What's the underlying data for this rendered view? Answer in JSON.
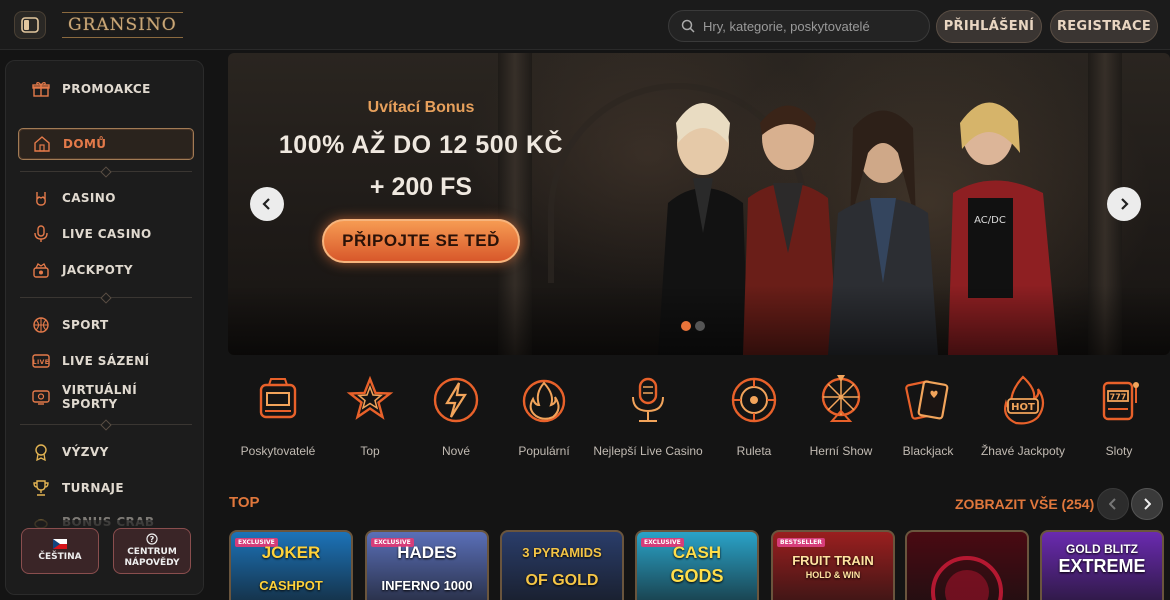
{
  "header": {
    "logo_text": "GRANSINO",
    "search_placeholder": "Hry, kategorie, poskytovatelé",
    "login_label": "PŘIHLÁŠENÍ",
    "register_label": "REGISTRACE"
  },
  "sidebar": {
    "items": [
      {
        "label": "PROMOAKCE",
        "icon": "gift-icon"
      },
      {
        "label": "DOMŮ",
        "icon": "home-icon",
        "active": true
      },
      {
        "label": "CASINO",
        "icon": "rock-hand-icon"
      },
      {
        "label": "LIVE CASINO",
        "icon": "microphone-icon"
      },
      {
        "label": "JACKPOTY",
        "icon": "jackpot-icon"
      },
      {
        "label": "SPORT",
        "icon": "basketball-icon"
      },
      {
        "label": "LIVE SÁZENÍ",
        "icon": "live-icon"
      },
      {
        "label": "VIRTUÁLNÍ SPORTY",
        "icon": "virtual-sports-icon"
      },
      {
        "label": "VÝZVY",
        "icon": "medal-icon"
      },
      {
        "label": "TURNAJE",
        "icon": "trophy-icon"
      },
      {
        "label": "BONUS CRAB",
        "icon": "crab-icon"
      }
    ],
    "language_label": "ČEŠTINA",
    "help_label_line1": "CENTRUM",
    "help_label_line2": "NÁPOVĚDY"
  },
  "hero": {
    "subtitle": "Uvítací Bonus",
    "title": "100% AŽ DO 12 500 KČ",
    "title_line2": "+ 200 FS",
    "cta_label": "PŘIPOJTE SE TEĎ",
    "slide_count": 2,
    "active_slide": 1
  },
  "categories": [
    {
      "label": "Poskytovatelé",
      "icon": "slot-machine-icon"
    },
    {
      "label": "Top",
      "icon": "star-icon"
    },
    {
      "label": "Nové",
      "icon": "lightning-icon"
    },
    {
      "label": "Populární",
      "icon": "flame-icon"
    },
    {
      "label": "Nejlepší Live Casino",
      "icon": "microphone-icon"
    },
    {
      "label": "Ruleta",
      "icon": "roulette-icon"
    },
    {
      "label": "Herní Show",
      "icon": "wheel-icon"
    },
    {
      "label": "Blackjack",
      "icon": "cards-icon"
    },
    {
      "label": "Žhavé Jackpoty",
      "icon": "hot-icon"
    },
    {
      "label": "Sloty",
      "icon": "slots-icon"
    }
  ],
  "top_section": {
    "title": "TOP",
    "show_all_label": "ZOBRAZIT VŠE (254)"
  },
  "games": [
    {
      "title": "JOKER",
      "subtitle": "CASHPOT",
      "badge": "EXCLUSIVE",
      "bg": "#1c73b8",
      "color": "#ffd23a"
    },
    {
      "title": "HADES",
      "subtitle": "INFERNO 1000",
      "badge": "EXCLUSIVE",
      "bg": "#5a6fb8",
      "color": "#ffffff"
    },
    {
      "title": "3 PYRAMIDS",
      "subtitle": "OF GOLD",
      "badge": "",
      "bg": "#2a3d6a",
      "color": "#f5c546"
    },
    {
      "title": "CASH",
      "subtitle": "GODS",
      "badge": "EXCLUSIVE",
      "bg": "#2aa3c8",
      "color": "#ffde4a"
    },
    {
      "title": "FRUIT TRAIN",
      "subtitle": "HOLD & WIN",
      "badge": "BESTSELLER",
      "bg": "#9a1f1f",
      "color": "#ffe3a0"
    },
    {
      "title": "",
      "subtitle": "",
      "badge": "",
      "bg": "#4a0a12",
      "color": "#ffffff"
    },
    {
      "title": "GOLD BLITZ",
      "subtitle": "EXTREME",
      "badge": "",
      "bg": "#6a2ab0",
      "color": "#ffffff"
    }
  ],
  "colors": {
    "accent": "#e0773c",
    "gold": "#c9a778",
    "background": "#141414"
  }
}
